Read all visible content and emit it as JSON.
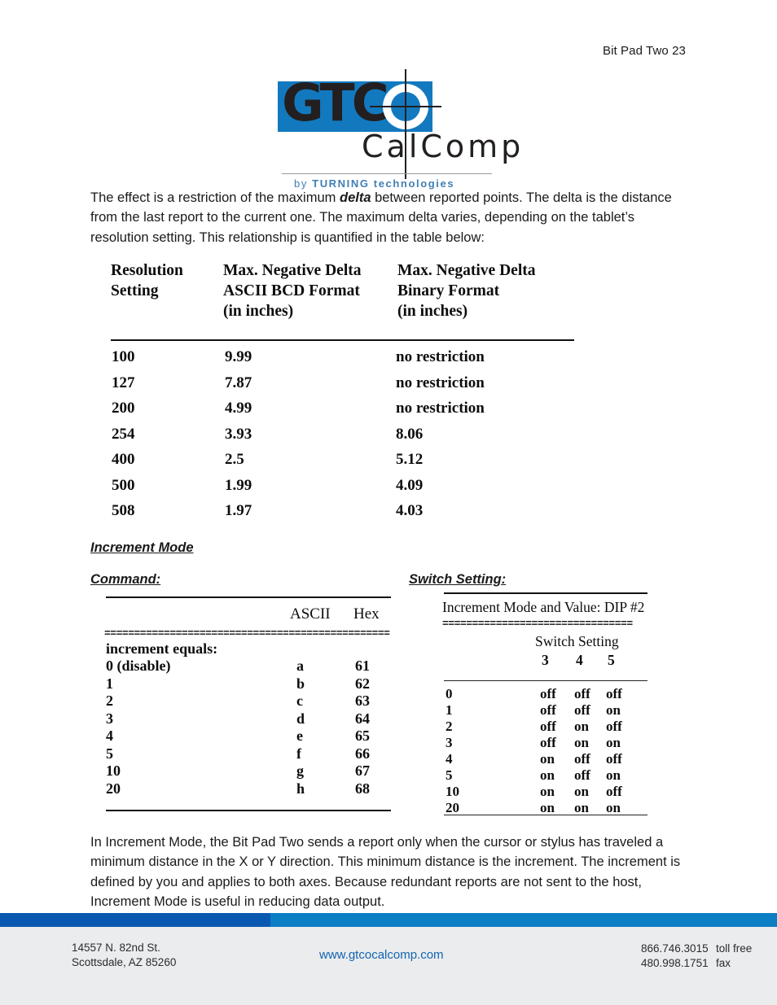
{
  "header": {
    "running_title": "Bit Pad Two 23"
  },
  "logo": {
    "wordmark": "GTC",
    "subword": "CalComp",
    "tagline_by": "by",
    "tagline_brand": "TURNING technologies",
    "blue": "#1379bf",
    "tagline_color": "#3f7fb4"
  },
  "body": {
    "paragraph_1_before": "The effect is a restriction of the maximum ",
    "paragraph_1_emphasis": "delta",
    "paragraph_1_after": " between reported points.  The delta is the distance from the last report to the current one.  The maximum delta varies, depending on the tablet’s resolution setting.  This relationship is quantified in the table below:",
    "paragraph_2": "In Increment Mode, the Bit Pad Two sends a report only when the cursor or stylus has traveled a minimum distance in the X or Y direction.  This minimum distance is the increment.  The increment is defined by you and applies to both axes.  Because redundant reports are not sent to the host, Increment Mode is useful in reducing data output."
  },
  "delta_table": {
    "headers": [
      "Resolution\nSetting",
      "Max. Negative Delta\nASCII BCD Format\n(in inches)",
      "Max. Negative Delta\nBinary Format\n(in inches)"
    ],
    "rows": [
      {
        "resolution": "100",
        "ascii_bcd": "9.99",
        "binary": "no restriction"
      },
      {
        "resolution": "127",
        "ascii_bcd": "7.87",
        "binary": "no restriction"
      },
      {
        "resolution": "200",
        "ascii_bcd": "4.99",
        "binary": "no restriction"
      },
      {
        "resolution": "254",
        "ascii_bcd": "3.93",
        "binary": "8.06"
      },
      {
        "resolution": "400",
        "ascii_bcd": "2.5",
        "binary": "5.12"
      },
      {
        "resolution": "500",
        "ascii_bcd": "1.99",
        "binary": "4.09"
      },
      {
        "resolution": "508",
        "ascii_bcd": "1.97",
        "binary": "4.03"
      }
    ]
  },
  "headings": {
    "increment_mode": "Increment Mode",
    "command": "Command:",
    "switch_setting": "Switch Setting:"
  },
  "command_table": {
    "col_ascii": "ASCII",
    "col_hex": "Hex",
    "group_label": "increment equals:",
    "divider": "================================================",
    "rows": [
      {
        "value": "0 (disable)",
        "ascii": "a",
        "hex": "61"
      },
      {
        "value": "1",
        "ascii": "b",
        "hex": "62"
      },
      {
        "value": "2",
        "ascii": "c",
        "hex": "63"
      },
      {
        "value": "3",
        "ascii": "d",
        "hex": "64"
      },
      {
        "value": "4",
        "ascii": "e",
        "hex": "65"
      },
      {
        "value": "5",
        "ascii": "f",
        "hex": "66"
      },
      {
        "value": "10",
        "ascii": "g",
        "hex": "67"
      },
      {
        "value": "20",
        "ascii": "h",
        "hex": "68"
      }
    ]
  },
  "switch_table": {
    "title": "Increment Mode and Value:  DIP #2",
    "divider": "================================",
    "group_label": "Switch Setting",
    "columns": [
      "3",
      "4",
      "5"
    ],
    "rows": [
      {
        "value": "0",
        "s3": "off",
        "s4": "off",
        "s5": "off"
      },
      {
        "value": "1",
        "s3": "off",
        "s4": "off",
        "s5": "on"
      },
      {
        "value": "2",
        "s3": "off",
        "s4": "on",
        "s5": "off"
      },
      {
        "value": "3",
        "s3": "off",
        "s4": "on",
        "s5": "on"
      },
      {
        "value": "4",
        "s3": "on",
        "s4": "off",
        "s5": "off"
      },
      {
        "value": "5",
        "s3": "on",
        "s4": "off",
        "s5": "on"
      },
      {
        "value": "10",
        "s3": "on",
        "s4": "on",
        "s5": "off"
      },
      {
        "value": "20",
        "s3": "on",
        "s4": "on",
        "s5": "on"
      }
    ]
  },
  "footer": {
    "address": "14557 N. 82nd St.\nScottsdale, AZ 85260",
    "url": "www.gtcocalcomp.com",
    "phone_tollfree_number": "866.746.3015",
    "phone_tollfree_label": "toll free",
    "phone_fax_number": "480.998.1751",
    "phone_fax_label": "fax",
    "bar_left_color": "#0a59b0",
    "bar_right_color": "#0b7ec4",
    "url_color": "#1263b0"
  }
}
